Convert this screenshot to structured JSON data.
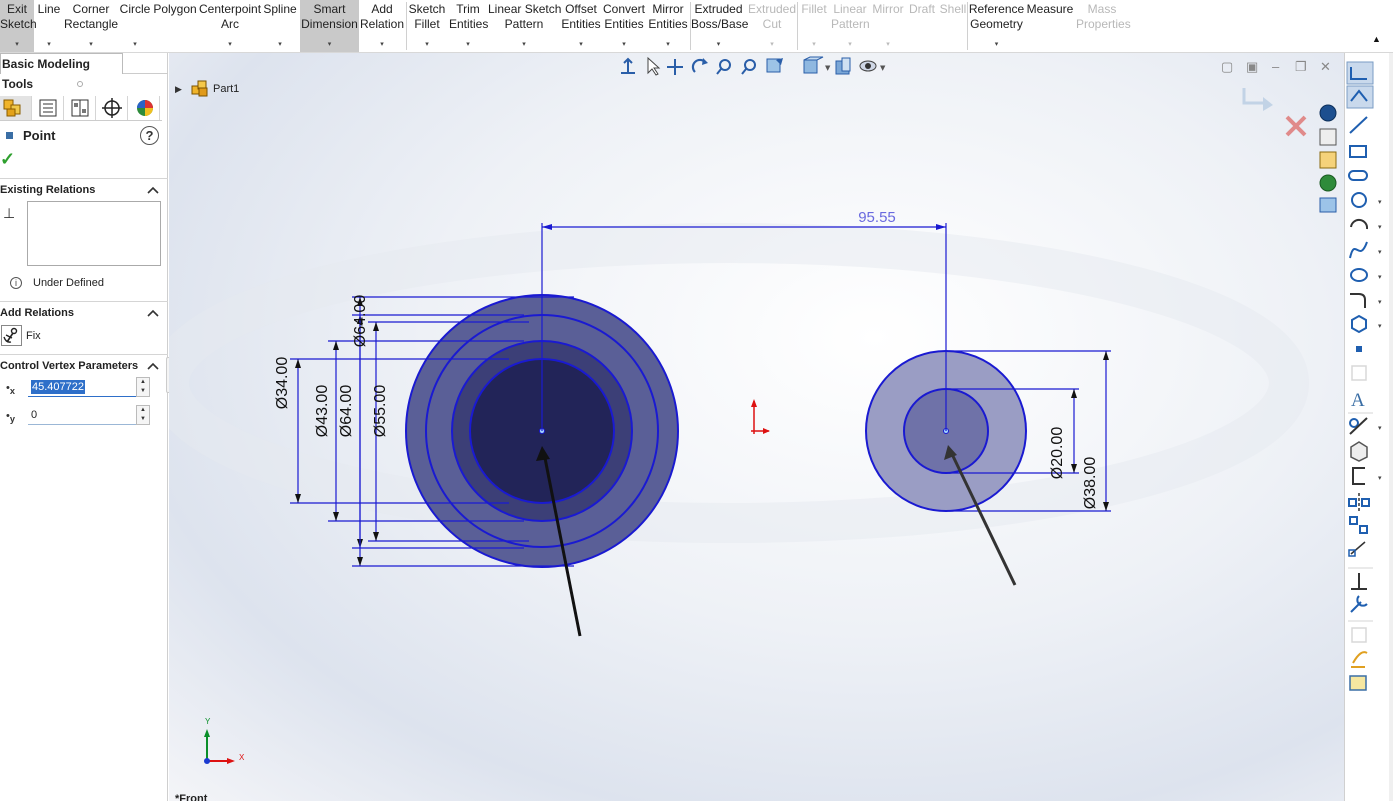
{
  "toolbar": {
    "items": [
      {
        "id": "exit-sketch",
        "line1": "Exit",
        "line2": "Sketch"
      },
      {
        "id": "line",
        "line1": "Line",
        "line2": ""
      },
      {
        "id": "corner-rectangle",
        "line1": "Corner",
        "line2": "Rectangle"
      },
      {
        "id": "circle",
        "line1": "Circle",
        "line2": ""
      },
      {
        "id": "polygon",
        "line1": "Polygon",
        "line2": ""
      },
      {
        "id": "centerpoint-arc",
        "line1": "Centerpoint",
        "line2": "Arc"
      },
      {
        "id": "spline",
        "line1": "Spline",
        "line2": ""
      },
      {
        "id": "smart-dimension",
        "line1": "Smart",
        "line2": "Dimension"
      },
      {
        "id": "add-relation",
        "line1": "Add",
        "line2": "Relation"
      },
      {
        "id": "sketch-fillet",
        "line1": "Sketch",
        "line2": "Fillet"
      },
      {
        "id": "trim-entities",
        "line1": "Trim",
        "line2": "Entities"
      },
      {
        "id": "linear-sketch-pattern",
        "line1": "Linear Sketch",
        "line2": "Pattern"
      },
      {
        "id": "offset-entities",
        "line1": "Offset",
        "line2": "Entities"
      },
      {
        "id": "convert-entities",
        "line1": "Convert",
        "line2": "Entities"
      },
      {
        "id": "mirror-entities",
        "line1": "Mirror",
        "line2": "Entities"
      },
      {
        "id": "extruded-boss-base",
        "line1": "Extruded",
        "line2": "Boss/Base"
      },
      {
        "id": "extruded-cut",
        "line1": "Extruded",
        "line2": "Cut"
      },
      {
        "id": "fillet",
        "line1": "Fillet",
        "line2": ""
      },
      {
        "id": "linear-pattern",
        "line1": "Linear",
        "line2": "Pattern"
      },
      {
        "id": "mirror",
        "line1": "Mirror",
        "line2": ""
      },
      {
        "id": "draft",
        "line1": "Draft",
        "line2": ""
      },
      {
        "id": "shell",
        "line1": "Shell",
        "line2": ""
      },
      {
        "id": "reference-geometry",
        "line1": "Reference",
        "line2": "Geometry"
      },
      {
        "id": "measure",
        "line1": "Measure",
        "line2": ""
      },
      {
        "id": "mass-properties",
        "line1": "Mass",
        "line2": "Properties"
      }
    ]
  },
  "left_panel": {
    "tab_label": "Basic Modeling Tools",
    "property_title": "Point",
    "help_glyph": "?",
    "ok_glyph": "✓",
    "existing_relations": {
      "header": "Existing Relations",
      "status": "Under Defined",
      "info_glyph": "i"
    },
    "add_relations": {
      "header": "Add Relations",
      "fix_label": "Fix"
    },
    "control_vertex": {
      "header": "Control Vertex Parameters",
      "x_label": "x",
      "y_label": "y",
      "x_value": "45.407722",
      "y_value": "0"
    }
  },
  "tree": {
    "part_name": "Part1",
    "view_name": "*Front"
  },
  "dimensions": {
    "horizontal": "95.55",
    "left": [
      "Ø34.00",
      "Ø43.00",
      "Ø64.00",
      "Ø55.00",
      "Ø64.00"
    ],
    "right": [
      "Ø20.00",
      "Ø38.00"
    ]
  },
  "triad": {
    "x_label": "X",
    "y_label": "Y"
  },
  "colors": {
    "sketch_blue": "#1a1ad1",
    "dim_text": "#6a6adf",
    "fill_outer": "#5a5f97",
    "fill_inner": "#222458",
    "fill_right_outer": "#9a9dc4",
    "fill_right_inner": "#6f72a8",
    "check_green": "#2ea02e",
    "selection_blue": "#2e6fc9"
  },
  "icons": [
    "part-icon",
    "help-icon",
    "checkmark-icon",
    "info-icon",
    "fix-anchor-icon",
    "origin-icon",
    "triad-icon",
    "close-icon",
    "confirm-icon"
  ]
}
